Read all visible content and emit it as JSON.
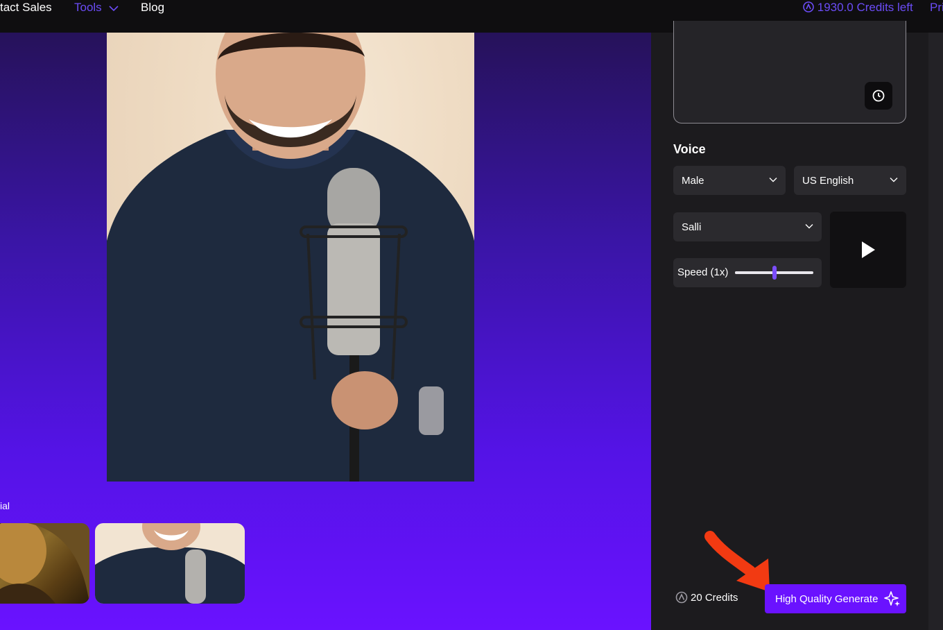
{
  "nav": {
    "contact_sales": "tact Sales",
    "tools": "Tools",
    "blog": "Blog",
    "credits_left": "1930.0 Credits left",
    "pricing_partial": "Pri"
  },
  "main": {
    "section_label": "ial"
  },
  "voice": {
    "title": "Voice",
    "gender": "Male",
    "language": "US English",
    "voice_name": "Salli",
    "speed_label": "Speed (1x)",
    "speed_level": 0.5
  },
  "footer": {
    "credits": "20 Credits",
    "generate_label": "High Quality Generate"
  },
  "colors": {
    "accent": "#6a12ff",
    "nav_accent": "#6b4cf6",
    "panel_bg": "#1c1b1e",
    "annotation_arrow": "#f23a12"
  },
  "icons": {
    "credits": "coin-a-icon",
    "history": "clock-icon",
    "play": "play-icon",
    "generate": "sparkle-icon"
  }
}
